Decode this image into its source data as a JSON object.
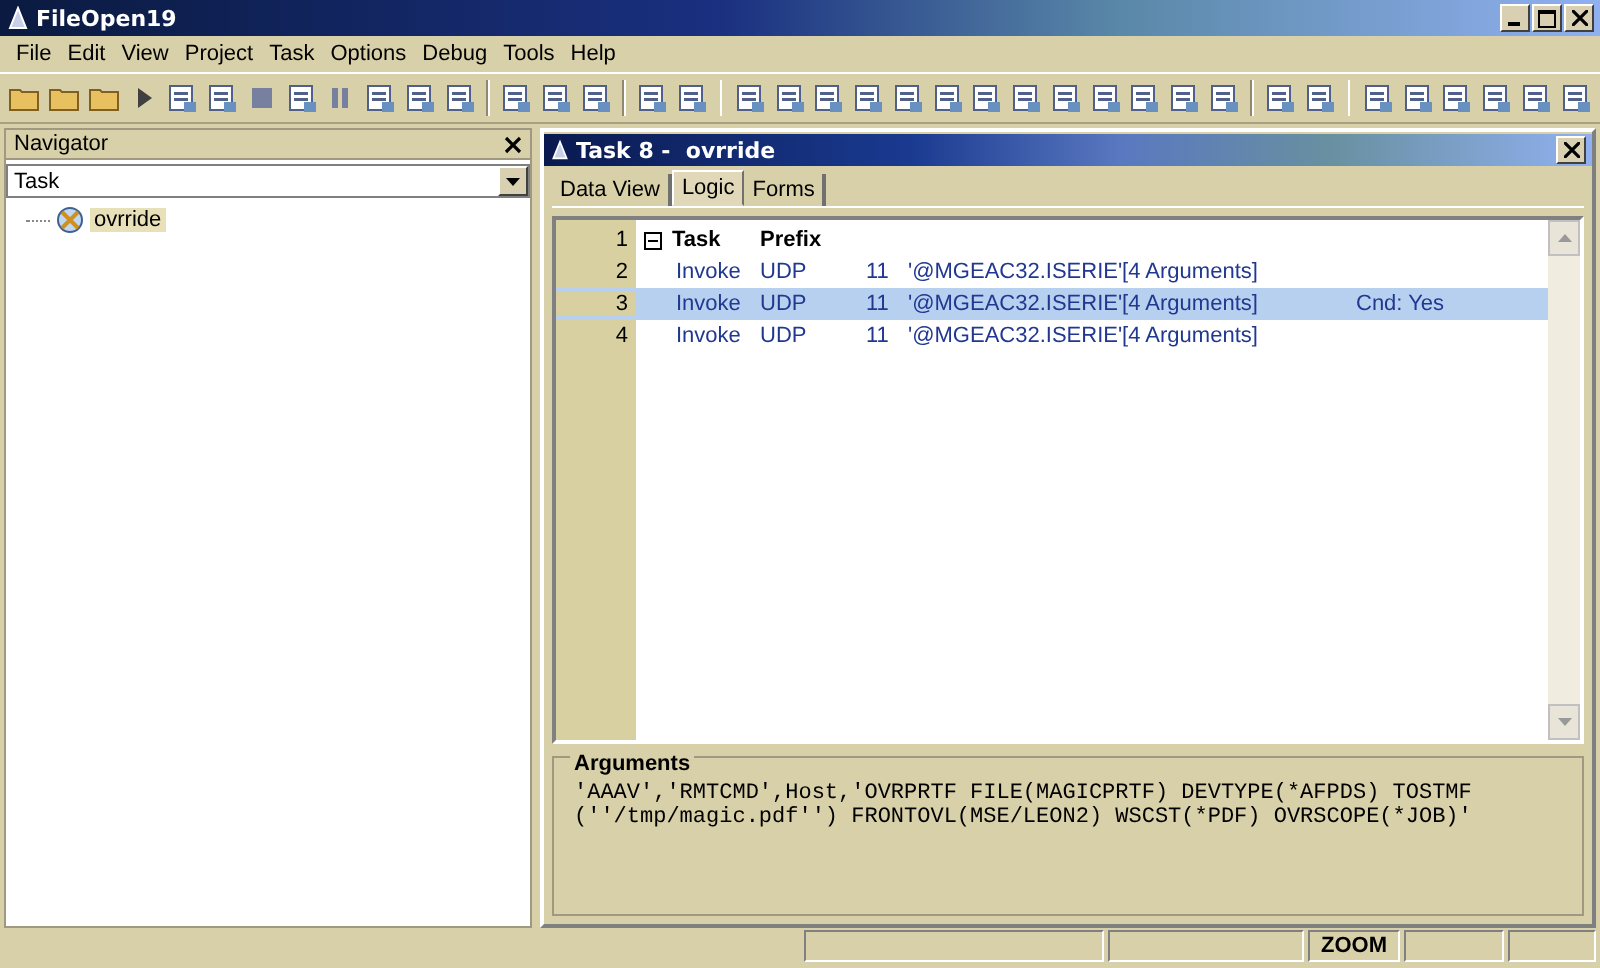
{
  "window": {
    "title": "FileOpen19"
  },
  "menu": [
    "File",
    "Edit",
    "View",
    "Project",
    "Task",
    "Options",
    "Debug",
    "Tools",
    "Help"
  ],
  "navigator": {
    "title": "Navigator",
    "combo_value": "Task",
    "tree": [
      {
        "label": "ovrride",
        "selected": true
      }
    ]
  },
  "task_window": {
    "title": "Task 8 -  ovrride",
    "tabs": [
      {
        "label": "Data View",
        "selected": false
      },
      {
        "label": "Logic",
        "selected": true
      },
      {
        "label": "Forms",
        "selected": false
      }
    ],
    "rows": [
      {
        "num": "1",
        "kind": "header",
        "expanded": true,
        "selected": false,
        "cells": [
          "Task",
          "Prefix"
        ]
      },
      {
        "num": "2",
        "kind": "line",
        "selected": false,
        "cells": [
          "Invoke",
          "UDP",
          "11",
          "'@MGEAC32.ISERIE'[4 Arguments]"
        ]
      },
      {
        "num": "3",
        "kind": "line",
        "selected": true,
        "cells": [
          "Invoke",
          "UDP",
          "11",
          "'@MGEAC32.ISERIE'[4 Arguments]",
          "Cnd: Yes"
        ]
      },
      {
        "num": "4",
        "kind": "line",
        "selected": false,
        "cells": [
          "Invoke",
          "UDP",
          "11",
          "'@MGEAC32.ISERIE'[4 Arguments]"
        ]
      }
    ],
    "arguments": {
      "title": "Arguments",
      "lines": [
        "'AAAV','RMTCMD',Host,'OVRPRTF FILE(MAGICPRTF) DEVTYPE(*AFPDS) TOSTMF",
        "(''/tmp/magic.pdf'') FRONTOVL(MSE/LEON2) WSCST(*PDF) OVRSCOPE(*JOB)'"
      ]
    }
  },
  "status_bar": {
    "indicator": "ZOOM"
  }
}
